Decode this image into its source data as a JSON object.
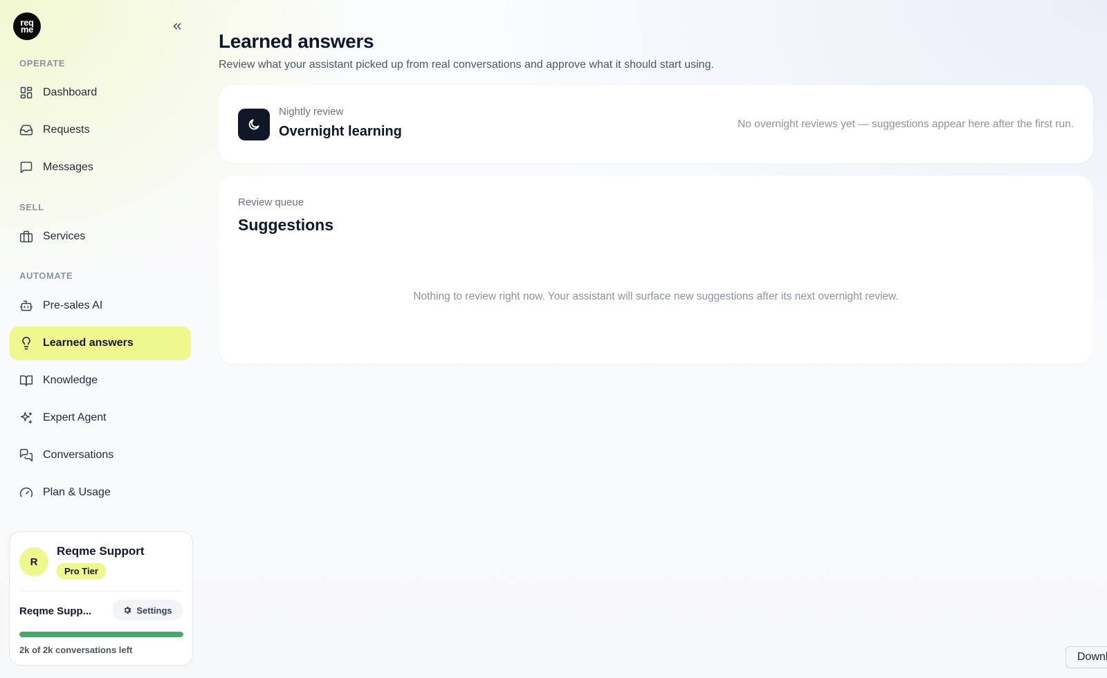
{
  "brand": {
    "logo_top": "req",
    "logo_bottom": "me"
  },
  "sidebar": {
    "sections": [
      {
        "label": "OPERATE"
      },
      {
        "label": "SELL"
      },
      {
        "label": "AUTOMATE"
      }
    ],
    "items": [
      {
        "label": "Dashboard",
        "icon": "dashboard-grid-icon"
      },
      {
        "label": "Requests",
        "icon": "inbox-icon"
      },
      {
        "label": "Messages",
        "icon": "message-square-icon"
      },
      {
        "label": "Services",
        "icon": "briefcase-icon"
      },
      {
        "label": "Pre-sales AI",
        "icon": "bot-icon"
      },
      {
        "label": "Learned answers",
        "icon": "lightbulb-icon",
        "active": true
      },
      {
        "label": "Knowledge",
        "icon": "book-open-icon"
      },
      {
        "label": "Expert Agent",
        "icon": "sparkles-icon"
      },
      {
        "label": "Conversations",
        "icon": "messages-icon"
      },
      {
        "label": "Plan & Usage",
        "icon": "gauge-icon"
      }
    ],
    "active_color": "#eef88f"
  },
  "account": {
    "avatar_initial": "R",
    "name": "Reqme Support",
    "tier": "Pro Tier",
    "short_name": "Reqme Supp...",
    "settings_label": "Settings",
    "usage_text": "2k of 2k conversations left",
    "usage_fraction": 1.0,
    "usage_color": "#4ba56e"
  },
  "main": {
    "title": "Learned answers",
    "subtitle": "Review what your assistant picked up from real conversations and approve what it should start using.",
    "overnight": {
      "kicker": "Nightly review",
      "heading": "Overnight learning",
      "note": "No overnight reviews yet — suggestions appear here after the first run."
    },
    "suggestions": {
      "kicker": "Review queue",
      "heading": "Suggestions",
      "empty_note": "Nothing to review right now. Your assistant will surface new suggestions after its next overnight review."
    }
  },
  "download_tab": {
    "label": "Downl"
  }
}
